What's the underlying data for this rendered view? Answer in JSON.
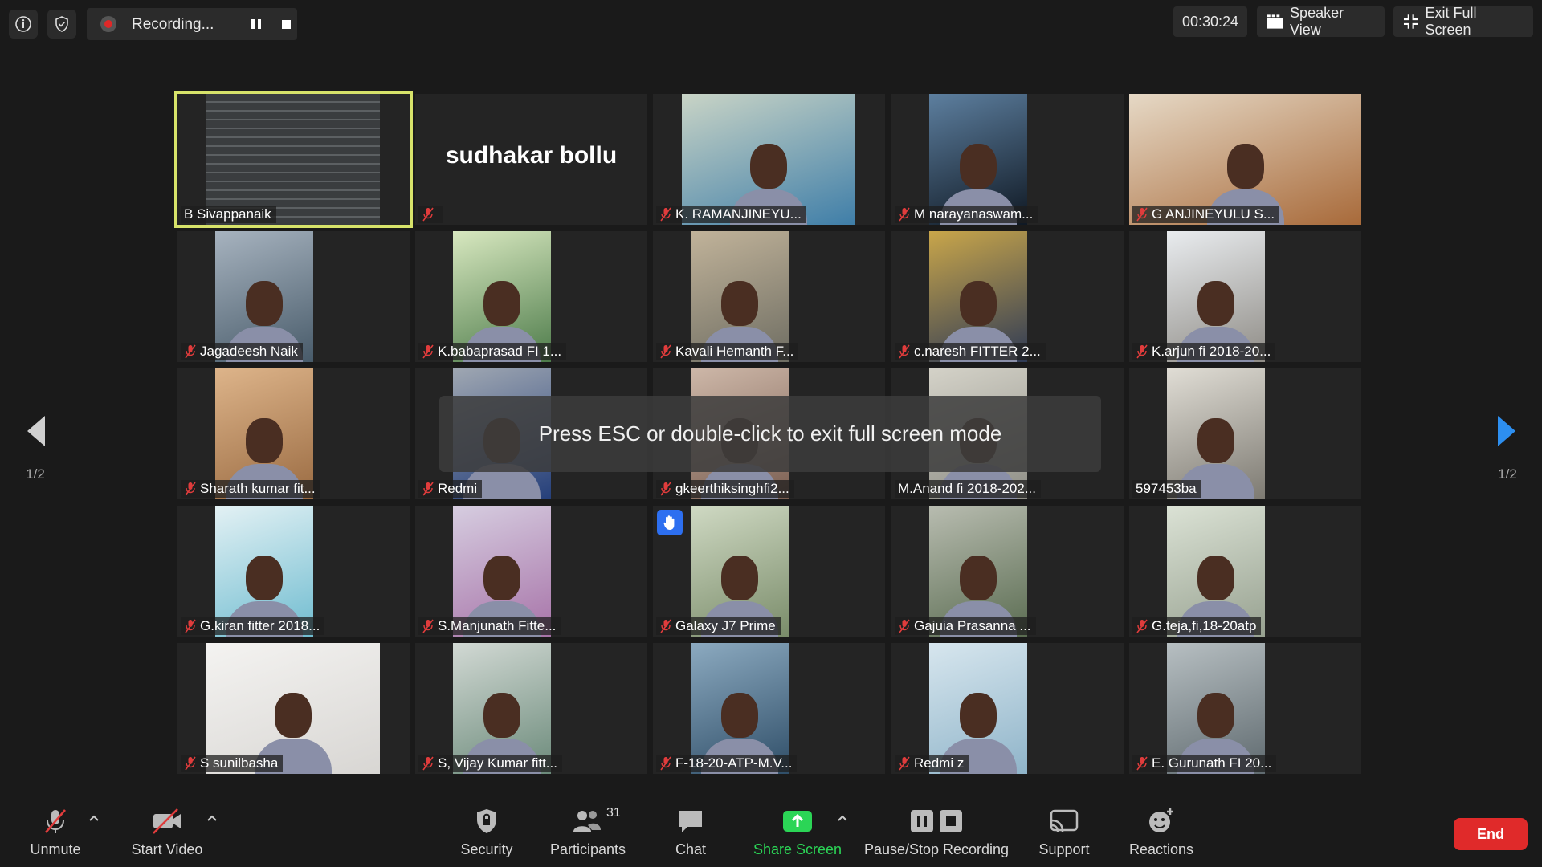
{
  "recording": {
    "label": "Recording..."
  },
  "timer": "00:30:24",
  "topbar": {
    "speaker_view": "Speaker View",
    "exit_full_screen": "Exit Full Screen"
  },
  "overlay_message": "Press ESC or double-click to exit full screen mode",
  "pager": {
    "left": "1/2",
    "right": "1/2"
  },
  "participants": [
    {
      "name": "B Sivappanaik",
      "muted": false,
      "active": true,
      "video": "board"
    },
    {
      "name": "",
      "display_name": "sudhakar bollu",
      "muted": true,
      "video": "none"
    },
    {
      "name": "K. RAMANJINEYU...",
      "muted": true,
      "video": "wide"
    },
    {
      "name": "M narayanaswam...",
      "muted": true,
      "video": "narrow"
    },
    {
      "name": "G ANJINEYULU S...",
      "muted": true,
      "video": "full"
    },
    {
      "name": "Jagadeesh Naik",
      "muted": true,
      "video": "narrow"
    },
    {
      "name": "K.babaprasad FI 1...",
      "muted": true,
      "video": "narrow"
    },
    {
      "name": "Kavali Hemanth F...",
      "muted": true,
      "video": "narrow"
    },
    {
      "name": "c.naresh FITTER 2...",
      "muted": true,
      "video": "narrow"
    },
    {
      "name": "K.arjun fi 2018-20...",
      "muted": true,
      "video": "narrow"
    },
    {
      "name": "Sharath kumar fit...",
      "muted": true,
      "video": "narrow"
    },
    {
      "name": "Redmi",
      "muted": true,
      "video": "narrow"
    },
    {
      "name": "gkeerthiksinghfi2...",
      "muted": true,
      "video": "narrow"
    },
    {
      "name": "M.Anand fi 2018-202...",
      "muted": false,
      "video": "narrow"
    },
    {
      "name": "597453ba",
      "muted": false,
      "video": "narrow"
    },
    {
      "name": "G.kiran fitter 2018...",
      "muted": true,
      "video": "narrow"
    },
    {
      "name": "S.Manjunath Fitte...",
      "muted": true,
      "video": "narrow"
    },
    {
      "name": "Galaxy J7 Prime",
      "muted": true,
      "video": "narrow",
      "hand_raised": true
    },
    {
      "name": "Gajuia Prasanna ...",
      "muted": true,
      "video": "narrow"
    },
    {
      "name": "G.teja,fi,18-20atp",
      "muted": true,
      "video": "narrow"
    },
    {
      "name": "S sunilbasha",
      "muted": true,
      "video": "wide"
    },
    {
      "name": "S, Vijay Kumar fitt...",
      "muted": true,
      "video": "narrow"
    },
    {
      "name": "F-18-20-ATP-M.V...",
      "muted": true,
      "video": "narrow"
    },
    {
      "name": "Redmi z",
      "muted": true,
      "video": "narrow"
    },
    {
      "name": "E. Gurunath FI 20...",
      "muted": true,
      "video": "narrow"
    }
  ],
  "toolbar": {
    "unmute": "Unmute",
    "start_video": "Start Video",
    "security": "Security",
    "participants": "Participants",
    "participants_count": "31",
    "chat": "Chat",
    "share_screen": "Share Screen",
    "pause_stop_recording": "Pause/Stop Recording",
    "support": "Support",
    "reactions": "Reactions",
    "end": "End"
  },
  "colors": {
    "background": "#1a1a1a",
    "tile": "#242424",
    "active_border": "#d7e36a",
    "share_green": "#2bd556",
    "end_red": "#e02a2a",
    "hand_blue": "#2d6ff0",
    "muted_red": "#e03c3c"
  }
}
